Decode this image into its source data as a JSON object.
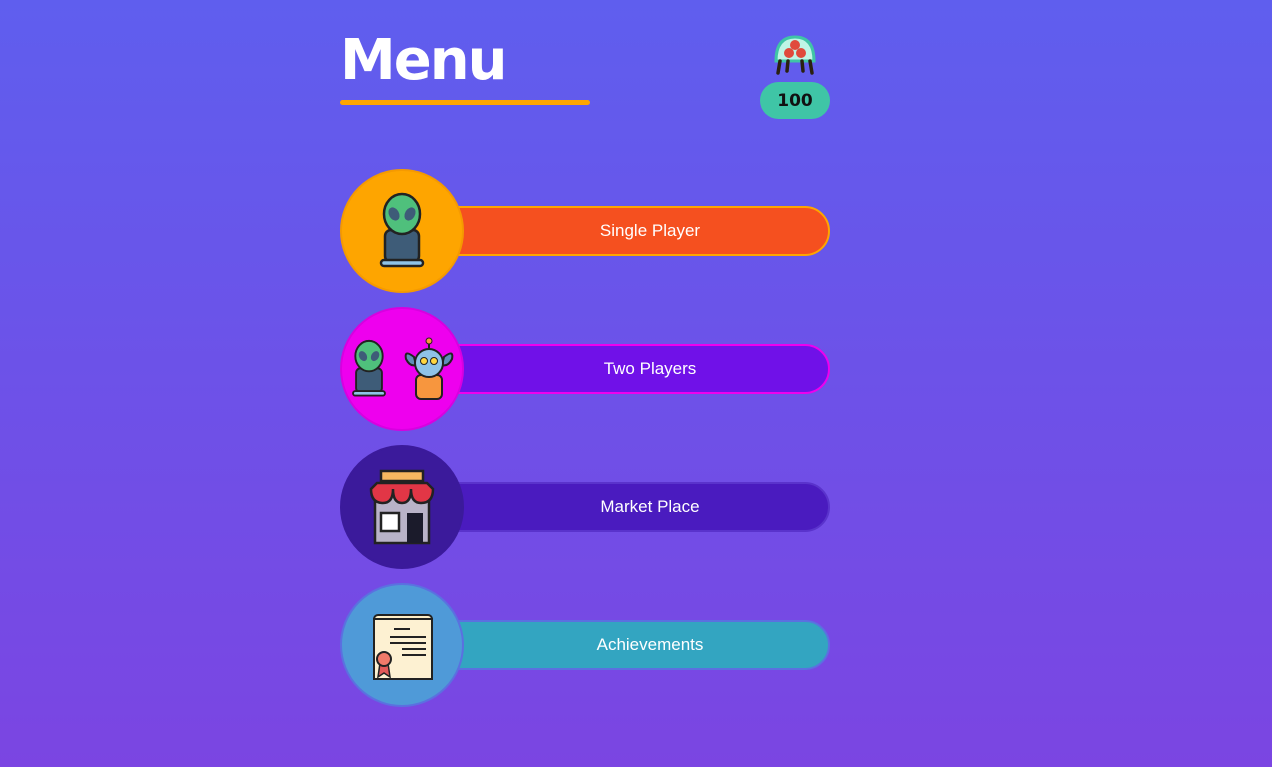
{
  "header": {
    "title": "Menu",
    "coins": "100",
    "coin_icon": "jellyfish-alien-icon"
  },
  "menu": [
    {
      "label": "Single Player",
      "icon": "alien-icon",
      "circle": "#fea500",
      "button": "#f5501f",
      "border": "#fea500"
    },
    {
      "label": "Two Players",
      "icon": "two-aliens-icon",
      "circle": "#ee00ee",
      "button": "#7011e8",
      "border": "#ee00ee"
    },
    {
      "label": "Market Place",
      "icon": "shop-icon",
      "circle": "#3b1a9b",
      "button": "#4a1bbf",
      "border": "#5a33cc"
    },
    {
      "label": "Achievements",
      "icon": "certificate-icon",
      "circle": "#4f9ad8",
      "button": "#33a5c1",
      "border": "#5b70e0"
    }
  ]
}
